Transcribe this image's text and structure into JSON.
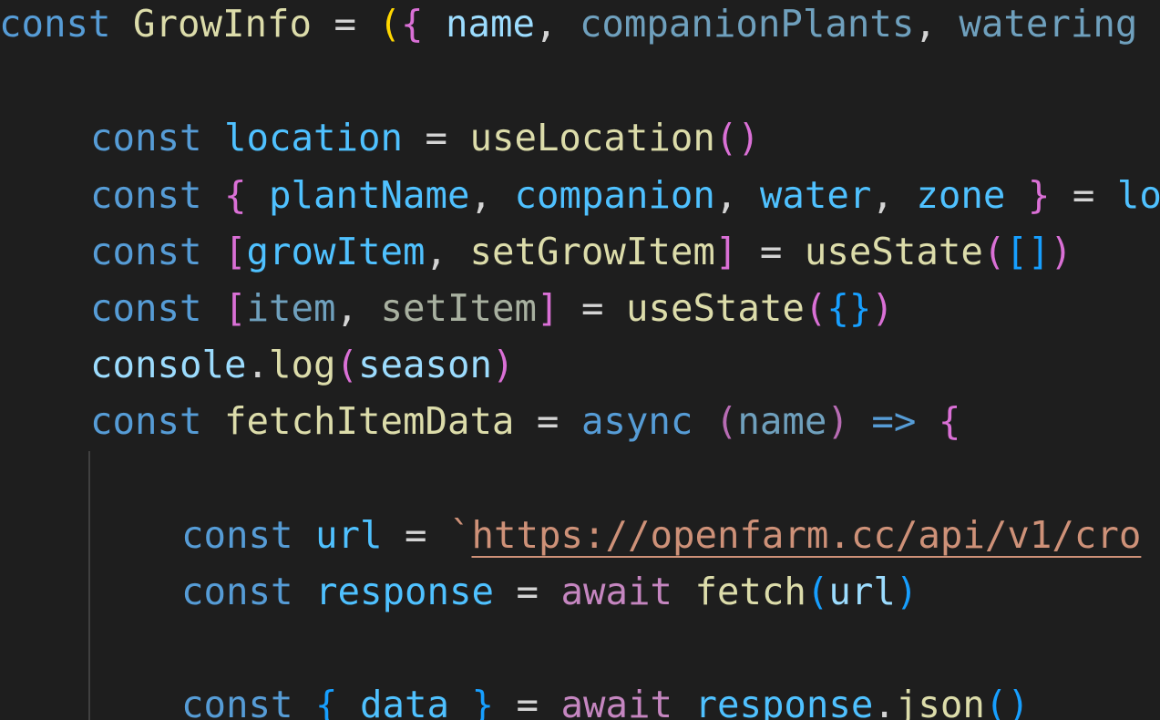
{
  "colors": {
    "background": "#1e1e1e",
    "keyword": "#569cd6",
    "function": "#dcdcaa",
    "variable": "#9cdcfe",
    "constant": "#4fc1ff",
    "unused": "#a8b0a0",
    "plain": "#d4d4d4",
    "string": "#ce9178",
    "control": "#c586c0",
    "bracket_gold": "#ffd700",
    "bracket_pink": "#da70d6",
    "bracket_blue": "#179fff",
    "indent_guide": "#404040"
  },
  "code_lines": [
    {
      "line": 1,
      "indent": 0,
      "tokens": [
        {
          "text": "const",
          "kind": "keyword"
        },
        {
          "text": " ",
          "kind": "plain"
        },
        {
          "text": "GrowInfo",
          "kind": "function"
        },
        {
          "text": " = ",
          "kind": "plain"
        },
        {
          "text": "(",
          "kind": "bracket_gold"
        },
        {
          "text": "{",
          "kind": "bracket_pink"
        },
        {
          "text": " ",
          "kind": "plain"
        },
        {
          "text": "name",
          "kind": "variable"
        },
        {
          "text": ", ",
          "kind": "plain"
        },
        {
          "text": "companionPlants",
          "kind": "unused_param"
        },
        {
          "text": ", ",
          "kind": "plain"
        },
        {
          "text": "watering",
          "kind": "unused_param"
        }
      ]
    },
    {
      "line": 2,
      "indent": 0,
      "tokens": []
    },
    {
      "line": 3,
      "indent": 1,
      "tokens": [
        {
          "text": "const",
          "kind": "keyword"
        },
        {
          "text": " ",
          "kind": "plain"
        },
        {
          "text": "location",
          "kind": "constant"
        },
        {
          "text": " = ",
          "kind": "plain"
        },
        {
          "text": "useLocation",
          "kind": "function"
        },
        {
          "text": "()",
          "kind": "bracket_pink"
        }
      ]
    },
    {
      "line": 4,
      "indent": 1,
      "tokens": [
        {
          "text": "const",
          "kind": "keyword"
        },
        {
          "text": " ",
          "kind": "plain"
        },
        {
          "text": "{",
          "kind": "bracket_pink"
        },
        {
          "text": " ",
          "kind": "plain"
        },
        {
          "text": "plantName",
          "kind": "constant"
        },
        {
          "text": ", ",
          "kind": "plain"
        },
        {
          "text": "companion",
          "kind": "constant"
        },
        {
          "text": ", ",
          "kind": "plain"
        },
        {
          "text": "water",
          "kind": "constant"
        },
        {
          "text": ", ",
          "kind": "plain"
        },
        {
          "text": "zone",
          "kind": "constant"
        },
        {
          "text": " ",
          "kind": "plain"
        },
        {
          "text": "}",
          "kind": "bracket_pink"
        },
        {
          "text": " = ",
          "kind": "plain"
        },
        {
          "text": "lo",
          "kind": "constant"
        }
      ]
    },
    {
      "line": 5,
      "indent": 1,
      "tokens": [
        {
          "text": "const",
          "kind": "keyword"
        },
        {
          "text": " ",
          "kind": "plain"
        },
        {
          "text": "[",
          "kind": "bracket_pink"
        },
        {
          "text": "growItem",
          "kind": "constant"
        },
        {
          "text": ", ",
          "kind": "plain"
        },
        {
          "text": "setGrowItem",
          "kind": "function"
        },
        {
          "text": "]",
          "kind": "bracket_pink"
        },
        {
          "text": " = ",
          "kind": "plain"
        },
        {
          "text": "useState",
          "kind": "function"
        },
        {
          "text": "(",
          "kind": "bracket_pink"
        },
        {
          "text": "[]",
          "kind": "bracket_blue"
        },
        {
          "text": ")",
          "kind": "bracket_pink"
        }
      ]
    },
    {
      "line": 6,
      "indent": 1,
      "tokens": [
        {
          "text": "const",
          "kind": "keyword"
        },
        {
          "text": " ",
          "kind": "plain"
        },
        {
          "text": "[",
          "kind": "bracket_pink"
        },
        {
          "text": "item",
          "kind": "unused_param"
        },
        {
          "text": ", ",
          "kind": "plain"
        },
        {
          "text": "setItem",
          "kind": "unused"
        },
        {
          "text": "]",
          "kind": "bracket_pink"
        },
        {
          "text": " = ",
          "kind": "plain"
        },
        {
          "text": "useState",
          "kind": "function"
        },
        {
          "text": "(",
          "kind": "bracket_pink"
        },
        {
          "text": "{}",
          "kind": "bracket_blue"
        },
        {
          "text": ")",
          "kind": "bracket_pink"
        }
      ]
    },
    {
      "line": 7,
      "indent": 1,
      "tokens": [
        {
          "text": "console",
          "kind": "variable_light"
        },
        {
          "text": ".",
          "kind": "plain"
        },
        {
          "text": "log",
          "kind": "function"
        },
        {
          "text": "(",
          "kind": "bracket_pink"
        },
        {
          "text": "season",
          "kind": "variable"
        },
        {
          "text": ")",
          "kind": "bracket_pink"
        }
      ]
    },
    {
      "line": 8,
      "indent": 1,
      "tokens": [
        {
          "text": "const",
          "kind": "keyword"
        },
        {
          "text": " ",
          "kind": "plain"
        },
        {
          "text": "fetchItemData",
          "kind": "function"
        },
        {
          "text": " = ",
          "kind": "plain"
        },
        {
          "text": "async",
          "kind": "keyword"
        },
        {
          "text": " ",
          "kind": "plain"
        },
        {
          "text": "(",
          "kind": "bracket_pink_dim"
        },
        {
          "text": "name",
          "kind": "unused_param"
        },
        {
          "text": ")",
          "kind": "bracket_pink_dim"
        },
        {
          "text": " ",
          "kind": "plain"
        },
        {
          "text": "=>",
          "kind": "keyword"
        },
        {
          "text": " ",
          "kind": "plain"
        },
        {
          "text": "{",
          "kind": "bracket_pink"
        }
      ]
    },
    {
      "line": 9,
      "indent": 2,
      "tokens": []
    },
    {
      "line": 10,
      "indent": 2,
      "tokens": [
        {
          "text": "const",
          "kind": "keyword"
        },
        {
          "text": " ",
          "kind": "plain"
        },
        {
          "text": "url",
          "kind": "constant"
        },
        {
          "text": " = ",
          "kind": "plain"
        },
        {
          "text": "`",
          "kind": "string"
        },
        {
          "text": "https://openfarm.cc/api/v1/cro",
          "kind": "string_url"
        }
      ]
    },
    {
      "line": 11,
      "indent": 2,
      "tokens": [
        {
          "text": "const",
          "kind": "keyword"
        },
        {
          "text": " ",
          "kind": "plain"
        },
        {
          "text": "response",
          "kind": "constant"
        },
        {
          "text": " = ",
          "kind": "plain"
        },
        {
          "text": "await",
          "kind": "control"
        },
        {
          "text": " ",
          "kind": "plain"
        },
        {
          "text": "fetch",
          "kind": "function"
        },
        {
          "text": "(",
          "kind": "bracket_blue"
        },
        {
          "text": "url",
          "kind": "variable"
        },
        {
          "text": ")",
          "kind": "bracket_blue"
        }
      ]
    },
    {
      "line": 12,
      "indent": 2,
      "tokens": []
    },
    {
      "line": 13,
      "indent": 2,
      "tokens": [
        {
          "text": "const",
          "kind": "keyword"
        },
        {
          "text": " ",
          "kind": "plain"
        },
        {
          "text": "{",
          "kind": "bracket_blue"
        },
        {
          "text": " ",
          "kind": "plain"
        },
        {
          "text": "data",
          "kind": "constant"
        },
        {
          "text": " ",
          "kind": "plain"
        },
        {
          "text": "}",
          "kind": "bracket_blue"
        },
        {
          "text": " = ",
          "kind": "plain"
        },
        {
          "text": "await",
          "kind": "control"
        },
        {
          "text": " ",
          "kind": "plain"
        },
        {
          "text": "response",
          "kind": "constant"
        },
        {
          "text": ".",
          "kind": "plain"
        },
        {
          "text": "json",
          "kind": "function"
        },
        {
          "text": "()",
          "kind": "bracket_blue"
        }
      ]
    }
  ]
}
